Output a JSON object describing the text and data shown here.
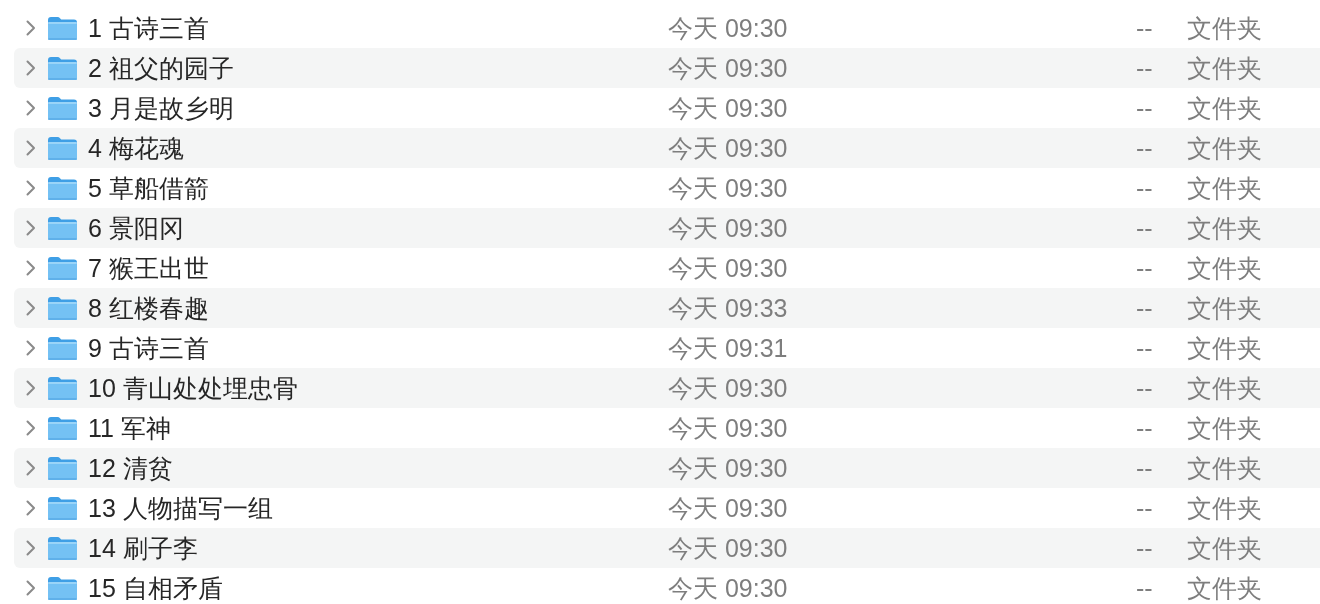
{
  "rows": [
    {
      "name": "1 古诗三首",
      "column_2": "今天 09:30",
      "column_3": "--",
      "column_4": "文件夹",
      "expanded": false,
      "selected": false
    },
    {
      "name": "2 祖父的园子",
      "column_2": "今天 09:30",
      "column_3": "--",
      "column_4": "文件夹",
      "expanded": false,
      "selected": false
    },
    {
      "name": "3 月是故乡明",
      "column_2": "今天 09:30",
      "column_3": "--",
      "column_4": "文件夹",
      "expanded": false,
      "selected": false
    },
    {
      "name": "4 梅花魂",
      "column_2": "今天 09:30",
      "column_3": "--",
      "column_4": "文件夹",
      "expanded": false,
      "selected": false
    },
    {
      "name": "5 草船借箭",
      "column_2": "今天 09:30",
      "column_3": "--",
      "column_4": "文件夹",
      "expanded": false,
      "selected": false
    },
    {
      "name": "6 景阳冈",
      "column_2": "今天 09:30",
      "column_3": "--",
      "column_4": "文件夹",
      "expanded": false,
      "selected": false
    },
    {
      "name": "7 猴王出世",
      "column_2": "今天 09:30",
      "column_3": "--",
      "column_4": "文件夹",
      "expanded": false,
      "selected": false
    },
    {
      "name": "8 红楼春趣",
      "column_2": "今天 09:33",
      "column_3": "--",
      "column_4": "文件夹",
      "expanded": false,
      "selected": false
    },
    {
      "name": "9 古诗三首",
      "column_2": "今天 09:31",
      "column_3": "--",
      "column_4": "文件夹",
      "expanded": false,
      "selected": false
    },
    {
      "name": "10 青山处处埋忠骨",
      "column_2": "今天 09:30",
      "column_3": "--",
      "column_4": "文件夹",
      "expanded": false,
      "selected": false
    },
    {
      "name": "11 军神",
      "column_2": "今天 09:30",
      "column_3": "--",
      "column_4": "文件夹",
      "expanded": false,
      "selected": false
    },
    {
      "name": "12 清贫",
      "column_2": "今天 09:30",
      "column_3": "--",
      "column_4": "文件夹",
      "expanded": false,
      "selected": false
    },
    {
      "name": "13 人物描写一组",
      "column_2": "今天 09:30",
      "column_3": "--",
      "column_4": "文件夹",
      "expanded": false,
      "selected": false
    },
    {
      "name": "14 刷子李",
      "column_2": "今天 09:30",
      "column_3": "--",
      "column_4": "文件夹",
      "expanded": false,
      "selected": false
    },
    {
      "name": "15 自相矛盾",
      "column_2": "今天 09:30",
      "column_3": "--",
      "column_4": "文件夹",
      "expanded": false,
      "selected": false
    }
  ]
}
